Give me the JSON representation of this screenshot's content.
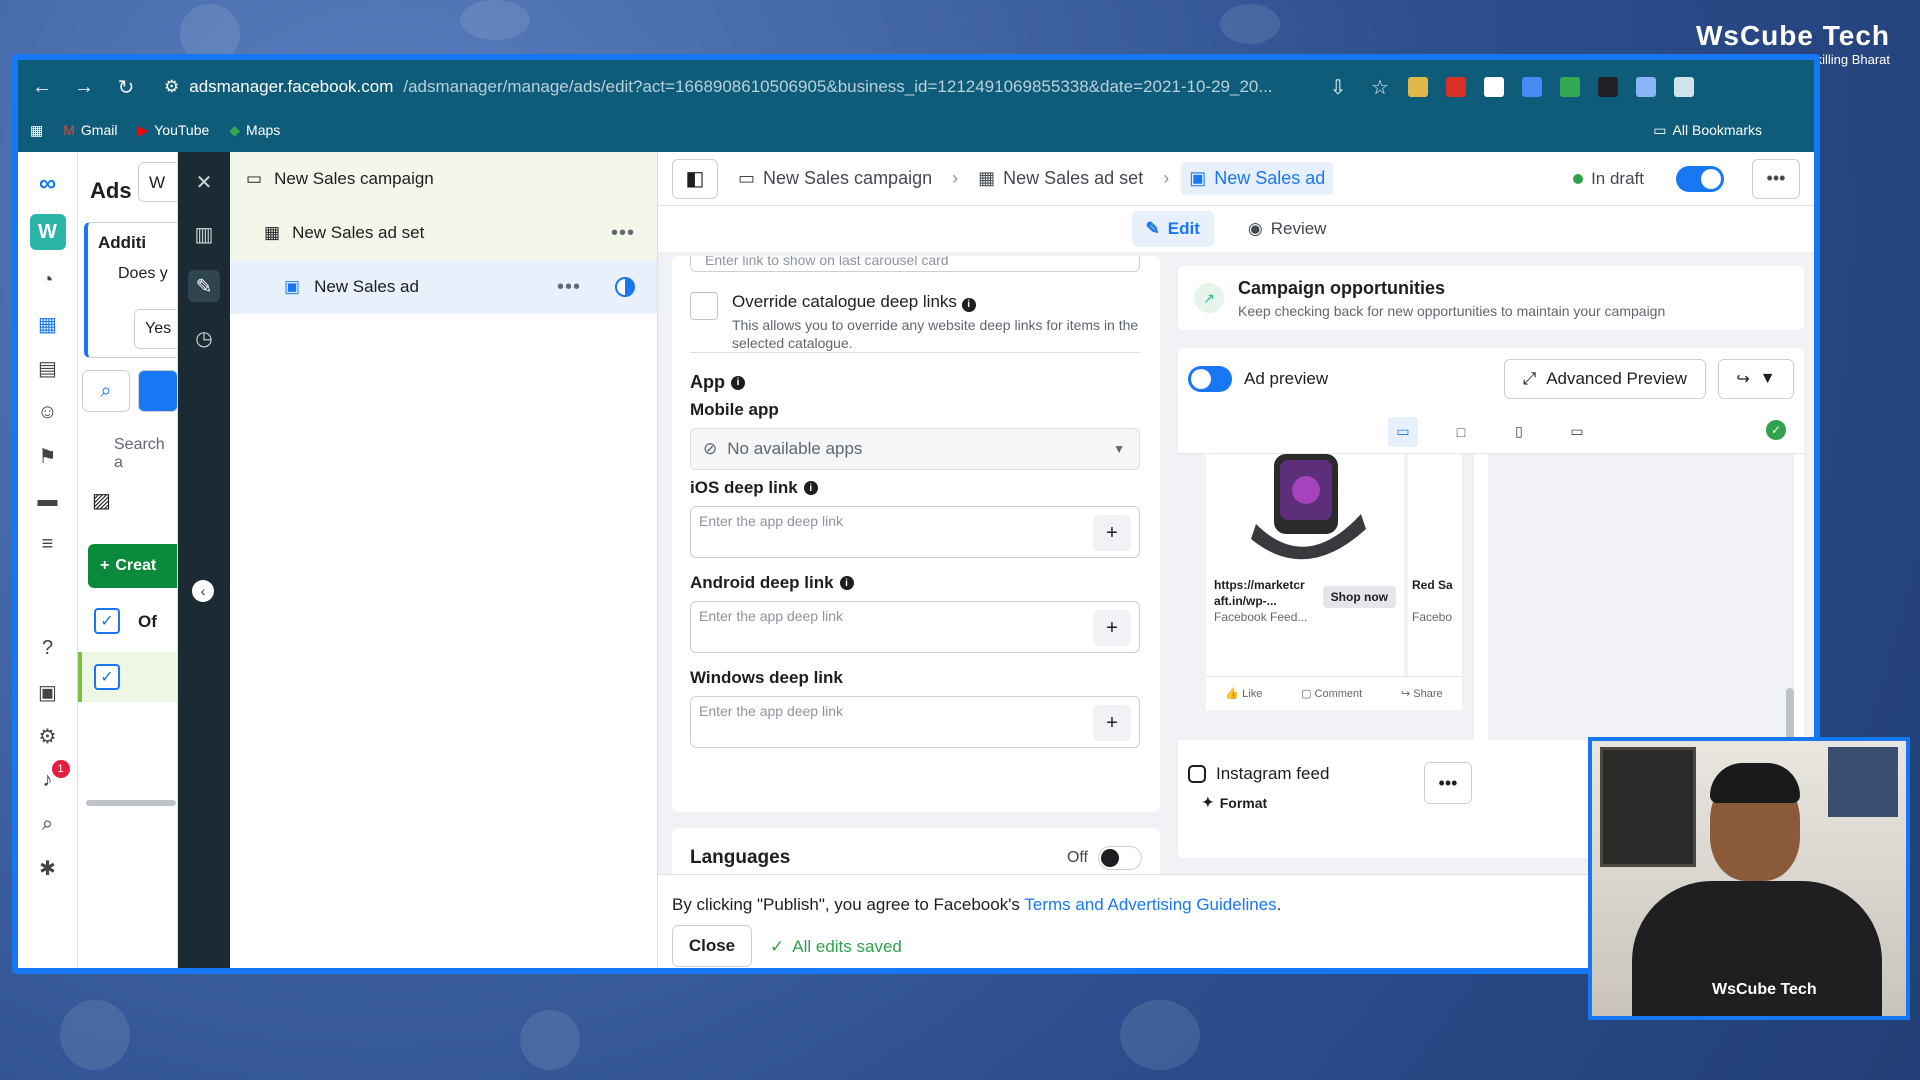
{
  "browser": {
    "url_host": "adsmanager.facebook.com",
    "url_path": "/adsmanager/manage/ads/edit?act=1668908610506905&business_id=1212491069855338&date=2021-10-29_20...",
    "bookmarks": [
      "Gmail",
      "YouTube",
      "Maps"
    ],
    "all_bookmarks": "All Bookmarks"
  },
  "brand": {
    "name": "WsCube Tech",
    "tagline": "Upskilling Bharat",
    "shirt": "WsCube Tech"
  },
  "under_panel": {
    "title": "Ads",
    "tab_partial": "W",
    "notice_partial": "Additi",
    "notice_q": "Does y",
    "yes_partial": "Yes",
    "search_placeholder": "Search a",
    "create_label": "Creat",
    "row_label": "Of"
  },
  "rail": {
    "workspace_initial": "W",
    "notification_count": "1"
  },
  "tree": {
    "campaign": "New Sales campaign",
    "adset": "New Sales ad set",
    "ad": "New Sales ad"
  },
  "topbar": {
    "crumbs": [
      "New Sales campaign",
      "New Sales ad set",
      "New Sales ad"
    ],
    "status": "In draft"
  },
  "tabs": {
    "edit": "Edit",
    "review": "Review"
  },
  "form": {
    "stub_placeholder": "Enter link to show on last carousel card",
    "override_title": "Override catalogue deep links",
    "override_desc": "This allows you to override any website deep links for items in the selected catalogue.",
    "app_heading": "App",
    "mobile_app_label": "Mobile app",
    "mobile_app_value": "No available apps",
    "ios_label": "iOS deep link",
    "android_label": "Android deep link",
    "windows_label": "Windows deep link",
    "deep_link_placeholder": "Enter the app deep link",
    "languages_label": "Languages",
    "languages_state": "Off"
  },
  "opportunities": {
    "title": "Campaign opportunities",
    "subtitle": "Keep checking back for new opportunities to maintain your campaign"
  },
  "preview": {
    "toggle_label": "Ad preview",
    "advanced_label": "Advanced Preview",
    "card_link": "https://marketcr aft.in/wp-...",
    "card_feed": "Facebook Feed...",
    "shop_now": "Shop now",
    "card2_title": "Red Sa",
    "card2_feed": "Facebo",
    "like": "Like",
    "comment": "Comment",
    "share": "Share",
    "instagram_label": "Instagram feed",
    "format_label": "Format"
  },
  "footer": {
    "terms_prefix": "By clicking \"Publish\", you agree to Facebook's ",
    "terms_link": "Terms and Advertising Guidelines",
    "terms_suffix": ".",
    "close_label": "Close",
    "saved_label": "All edits saved"
  },
  "colors": {
    "accent": "#1877f2",
    "success": "#31a24c",
    "frame": "#1677f2",
    "toolbar": "#0f5c7a"
  }
}
